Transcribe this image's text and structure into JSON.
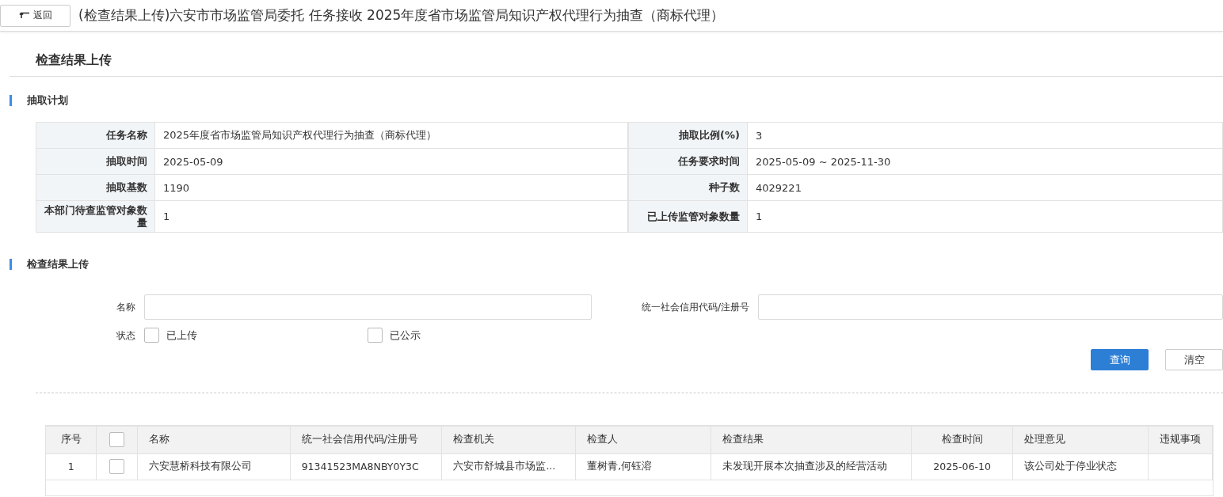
{
  "top_bar": {
    "back_button": "返回",
    "title": "(检查结果上传)六安市市场监管局委托 任务接收 2025年度省市场监管局知识产权代理行为抽查（商标代理）"
  },
  "page_title": "检查结果上传",
  "plan_section": {
    "title": "抽取计划",
    "rows": [
      [
        {
          "label": "任务名称",
          "value": "2025年度省市场监管局知识产权代理行为抽查（商标代理）"
        },
        {
          "label": "抽取比例(%)",
          "value": "3"
        }
      ],
      [
        {
          "label": "抽取时间",
          "value": "2025-05-09"
        },
        {
          "label": "任务要求时间",
          "value": "2025-05-09 ~ 2025-11-30"
        }
      ],
      [
        {
          "label": "抽取基数",
          "value": "1190"
        },
        {
          "label": "种子数",
          "value": "4029221"
        }
      ],
      [
        {
          "label": "本部门待查监管对象数量",
          "value": "1"
        },
        {
          "label": "已上传监管对象数量",
          "value": "1"
        }
      ]
    ]
  },
  "upload_section": {
    "title": "检查结果上传",
    "fields": [
      {
        "label": "名称"
      },
      {
        "label": "统一社会信用代码/注册号"
      }
    ],
    "status": {
      "label": "状态",
      "options": [
        {
          "label": "已上传",
          "checked": false
        },
        {
          "label": "已公示",
          "checked": false
        }
      ]
    },
    "buttons": [
      {
        "label": "查询",
        "kind": "primary"
      },
      {
        "label": "清空",
        "kind": "secondary"
      }
    ]
  },
  "table": {
    "select_all_checked": false,
    "columns": [
      {
        "label": "序号",
        "kind": "text"
      },
      {
        "kind": "checkbox"
      },
      {
        "label": "名称",
        "kind": "text"
      },
      {
        "label": "统一社会信用代码/注册号",
        "kind": "text"
      },
      {
        "label": "检查机关",
        "kind": "text"
      },
      {
        "label": "检查人",
        "kind": "text"
      },
      {
        "label": "检查结果",
        "kind": "text"
      },
      {
        "label": "检查时间",
        "kind": "text"
      },
      {
        "label": "处理意见",
        "kind": "text"
      },
      {
        "label": "违规事项",
        "kind": "text"
      }
    ],
    "rows": [
      {
        "checked": false,
        "cells": [
          "1",
          null,
          "六安慧桥科技有限公司",
          "91341523MA8NBY0Y3C",
          "六安市舒城县市场监...",
          "董树青,何钰溶",
          "未发现开展本次抽查涉及的经营活动",
          "2025-06-10",
          "该公司处于停业状态",
          null
        ]
      }
    ]
  }
}
